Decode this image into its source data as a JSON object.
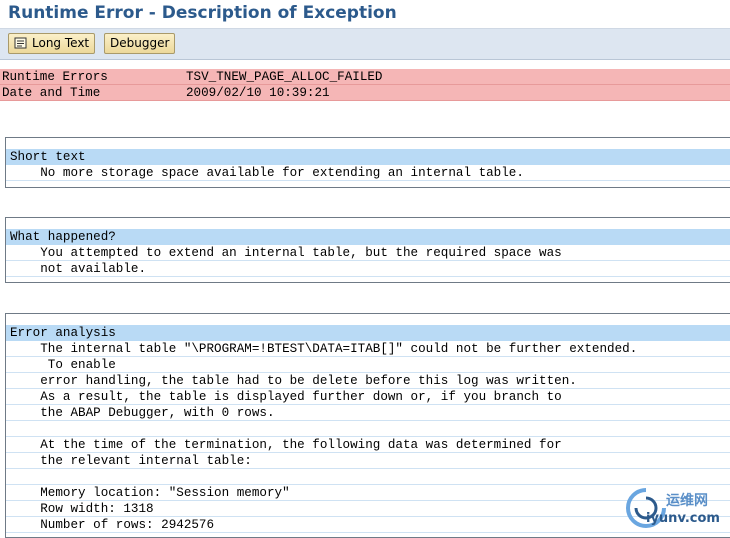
{
  "window": {
    "title": "Runtime Error - Description of Exception"
  },
  "toolbar": {
    "long_text_label": "Long Text",
    "debugger_label": "Debugger"
  },
  "header": {
    "rows": [
      {
        "label": "Runtime Errors",
        "value": "TSV_TNEW_PAGE_ALLOC_FAILED"
      },
      {
        "label": "Date and Time",
        "value": "2009/02/10 10:39:21"
      }
    ]
  },
  "sections": {
    "short_text": {
      "heading": "Short text",
      "lines": [
        "    No more storage space available for extending an internal table."
      ]
    },
    "what_happened": {
      "heading": "What happened?",
      "lines": [
        "    You attempted to extend an internal table, but the required space was",
        "    not available."
      ]
    },
    "error_analysis": {
      "heading": "Error analysis",
      "lines": [
        "    The internal table \"\\PROGRAM=!BTEST\\DATA=ITAB[]\" could not be further extended.",
        "     To enable",
        "    error handling, the table had to be delete before this log was written.",
        "    As a result, the table is displayed further down or, if you branch to",
        "    the ABAP Debugger, with 0 rows.",
        "",
        "    At the time of the termination, the following data was determined for",
        "    the relevant internal table:",
        "",
        "    Memory location: \"Session memory\"",
        "    Row width: 1318",
        "    Number of rows: 2942576"
      ]
    }
  },
  "watermark": {
    "brand": "运维网",
    "url": "iyunv.com"
  },
  "colors": {
    "title": "#2c5a8c",
    "header_row": "#f5b6b6",
    "section_heading": "#b9daf5",
    "toolbar": "#dde6f1"
  }
}
